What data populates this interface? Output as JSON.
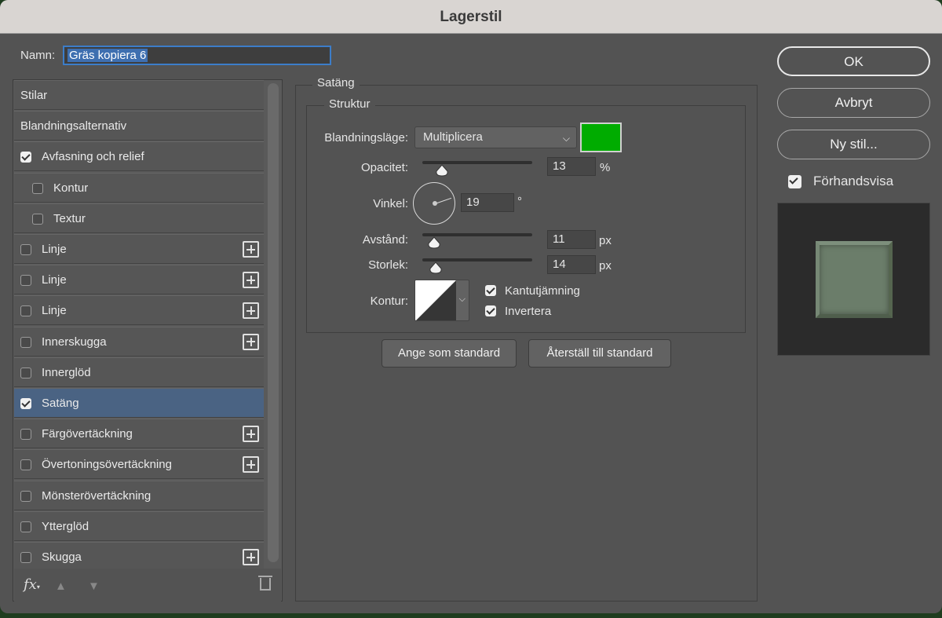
{
  "window": {
    "title": "Lagerstil"
  },
  "name": {
    "label": "Namn:",
    "value": "Gräs kopiera 6"
  },
  "style_list": {
    "items": [
      {
        "label": "Stilar",
        "checkbox": false,
        "checked": false,
        "indent": false,
        "plus": false,
        "selected": false
      },
      {
        "label": "Blandningsalternativ",
        "checkbox": false,
        "checked": false,
        "indent": false,
        "plus": false,
        "selected": false
      },
      {
        "label": "Avfasning och relief",
        "checkbox": true,
        "checked": true,
        "indent": false,
        "plus": false,
        "selected": false
      },
      {
        "label": "Kontur",
        "checkbox": true,
        "checked": false,
        "indent": true,
        "plus": false,
        "selected": false
      },
      {
        "label": "Textur",
        "checkbox": true,
        "checked": false,
        "indent": true,
        "plus": false,
        "selected": false
      },
      {
        "label": "Linje",
        "checkbox": true,
        "checked": false,
        "indent": false,
        "plus": true,
        "selected": false
      },
      {
        "label": "Linje",
        "checkbox": true,
        "checked": false,
        "indent": false,
        "plus": true,
        "selected": false
      },
      {
        "label": "Linje",
        "checkbox": true,
        "checked": false,
        "indent": false,
        "plus": true,
        "selected": false
      },
      {
        "label": "Innerskugga",
        "checkbox": true,
        "checked": false,
        "indent": false,
        "plus": true,
        "selected": false
      },
      {
        "label": "Innerglöd",
        "checkbox": true,
        "checked": false,
        "indent": false,
        "plus": false,
        "selected": false
      },
      {
        "label": "Satäng",
        "checkbox": true,
        "checked": true,
        "indent": false,
        "plus": false,
        "selected": true
      },
      {
        "label": "Färgövertäckning",
        "checkbox": true,
        "checked": false,
        "indent": false,
        "plus": true,
        "selected": false
      },
      {
        "label": "Övertoningsövertäckning",
        "checkbox": true,
        "checked": false,
        "indent": false,
        "plus": true,
        "selected": false
      },
      {
        "label": "Mönsterövertäckning",
        "checkbox": true,
        "checked": false,
        "indent": false,
        "plus": false,
        "selected": false
      },
      {
        "label": "Ytterglöd",
        "checkbox": true,
        "checked": false,
        "indent": false,
        "plus": false,
        "selected": false
      },
      {
        "label": "Skugga",
        "checkbox": true,
        "checked": false,
        "indent": false,
        "plus": true,
        "selected": false
      }
    ],
    "footer": {
      "fx": "fx"
    }
  },
  "satin": {
    "title": "Satäng",
    "structure_title": "Struktur",
    "blend_mode": {
      "label": "Blandningsläge:",
      "value": "Multiplicera",
      "color": "#00ac00"
    },
    "opacity": {
      "label": "Opacitet:",
      "value": "13",
      "unit": "%",
      "fraction": 0.13
    },
    "angle": {
      "label": "Vinkel:",
      "value": "19",
      "unit": "°"
    },
    "distance": {
      "label": "Avstånd:",
      "value": "11",
      "unit": "px",
      "fraction": 0.06
    },
    "size": {
      "label": "Storlek:",
      "value": "14",
      "unit": "px",
      "fraction": 0.07
    },
    "contour": {
      "label": "Kontur:"
    },
    "antialias": {
      "label": "Kantutjämning",
      "checked": true
    },
    "invert": {
      "label": "Invertera",
      "checked": true
    },
    "set_default": "Ange som standard",
    "reset_default": "Återställ till standard"
  },
  "actions": {
    "ok": "OK",
    "cancel": "Avbryt",
    "new_style": "Ny stil...",
    "preview": {
      "label": "Förhandsvisa",
      "checked": true
    }
  },
  "icons": {
    "fx": "fx-icon",
    "up": "arrow-up-icon",
    "down": "arrow-down-icon",
    "trash": "trash-icon",
    "plus": "plus-icon",
    "chevron": "chevron-down-icon"
  }
}
